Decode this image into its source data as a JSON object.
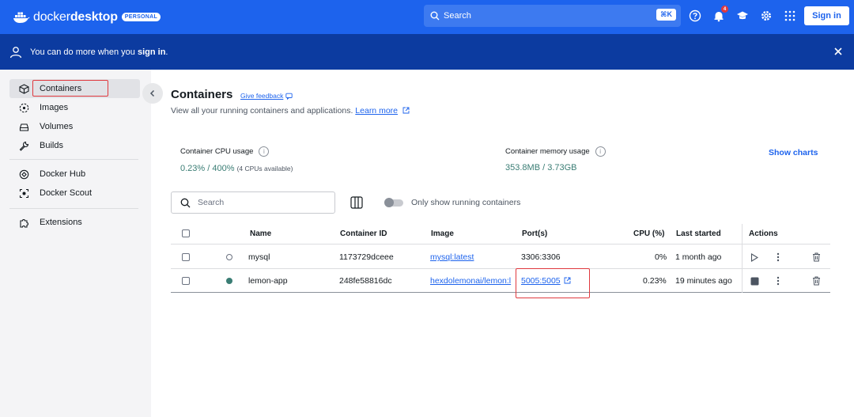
{
  "topbar": {
    "brand_light": "docker",
    "brand_bold": "desktop",
    "badge": "PERSONAL",
    "search_placeholder": "Search",
    "shortcut": "⌘K",
    "notification_count": "4",
    "signin_label": "Sign in",
    "icons": [
      "help-icon",
      "bell-icon",
      "learn-icon",
      "gear-icon",
      "apps-grid-icon"
    ]
  },
  "banner": {
    "text_before": "You can do more when you ",
    "text_bold": "sign in",
    "text_after": "."
  },
  "sidebar": {
    "items": [
      {
        "label": "Containers",
        "icon": "container-icon",
        "active": true
      },
      {
        "label": "Images",
        "icon": "image-icon"
      },
      {
        "label": "Volumes",
        "icon": "volume-icon"
      },
      {
        "label": "Builds",
        "icon": "wrench-icon"
      },
      {
        "label": "Docker Hub",
        "icon": "hub-icon"
      },
      {
        "label": "Docker Scout",
        "icon": "scout-icon"
      },
      {
        "label": "Extensions",
        "icon": "puzzle-icon"
      }
    ]
  },
  "main": {
    "title": "Containers",
    "feedback": "Give feedback",
    "subtitle": "View all your running containers and applications. ",
    "learn_more": "Learn more",
    "cpu_label": "Container CPU usage",
    "cpu_value": "0.23% / 400%",
    "cpu_note": "(4 CPUs available)",
    "mem_label": "Container memory usage",
    "mem_value": "353.8MB / 3.73GB",
    "show_charts": "Show charts",
    "search_placeholder": "Search",
    "toggle_label": "Only show running containers",
    "columns": [
      "Name",
      "Container ID",
      "Image",
      "Port(s)",
      "CPU (%)",
      "Last started",
      "Actions"
    ],
    "rows": [
      {
        "name": "mysql",
        "id": "1173729dceee",
        "image": "mysql:latest",
        "ports": "3306:3306",
        "cpu": "0%",
        "started": "1 month ago",
        "status": "stopped"
      },
      {
        "name": "lemon-app",
        "id": "248fe58816dc",
        "image": "hexdolemonai/lemon:l",
        "ports": "5005:5005",
        "cpu": "0.23%",
        "started": "19 minutes ago",
        "status": "running"
      }
    ]
  },
  "colors": {
    "brand_blue": "#1d63ed",
    "banner_navy": "#0c3ba0",
    "highlight_red": "#e0393e",
    "running_green": "#3a7d74"
  }
}
